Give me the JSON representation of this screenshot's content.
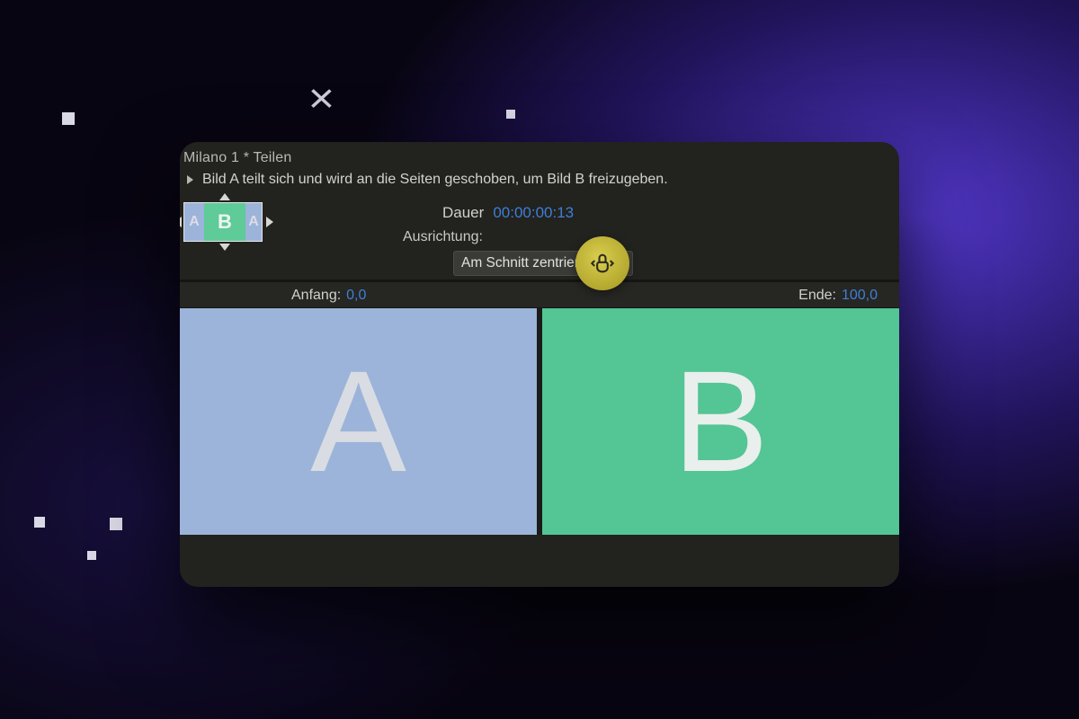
{
  "header": {
    "breadcrumb": "Milano 1 * Teilen",
    "description": "Bild A teilt sich und wird an die Seiten geschoben, um Bild B freizugeben."
  },
  "duration": {
    "label": "Dauer",
    "value": "00:00:00:13"
  },
  "alignment": {
    "label": "Ausrichtung:",
    "selected": "Am Schnitt zentrieren"
  },
  "range": {
    "start_label": "Anfang:",
    "start_value": "0,0",
    "end_label": "Ende:",
    "end_value": "100,0"
  },
  "thumb": {
    "a": "A",
    "b": "B",
    "a2": "A"
  },
  "preview": {
    "a": "A",
    "b": "B"
  }
}
